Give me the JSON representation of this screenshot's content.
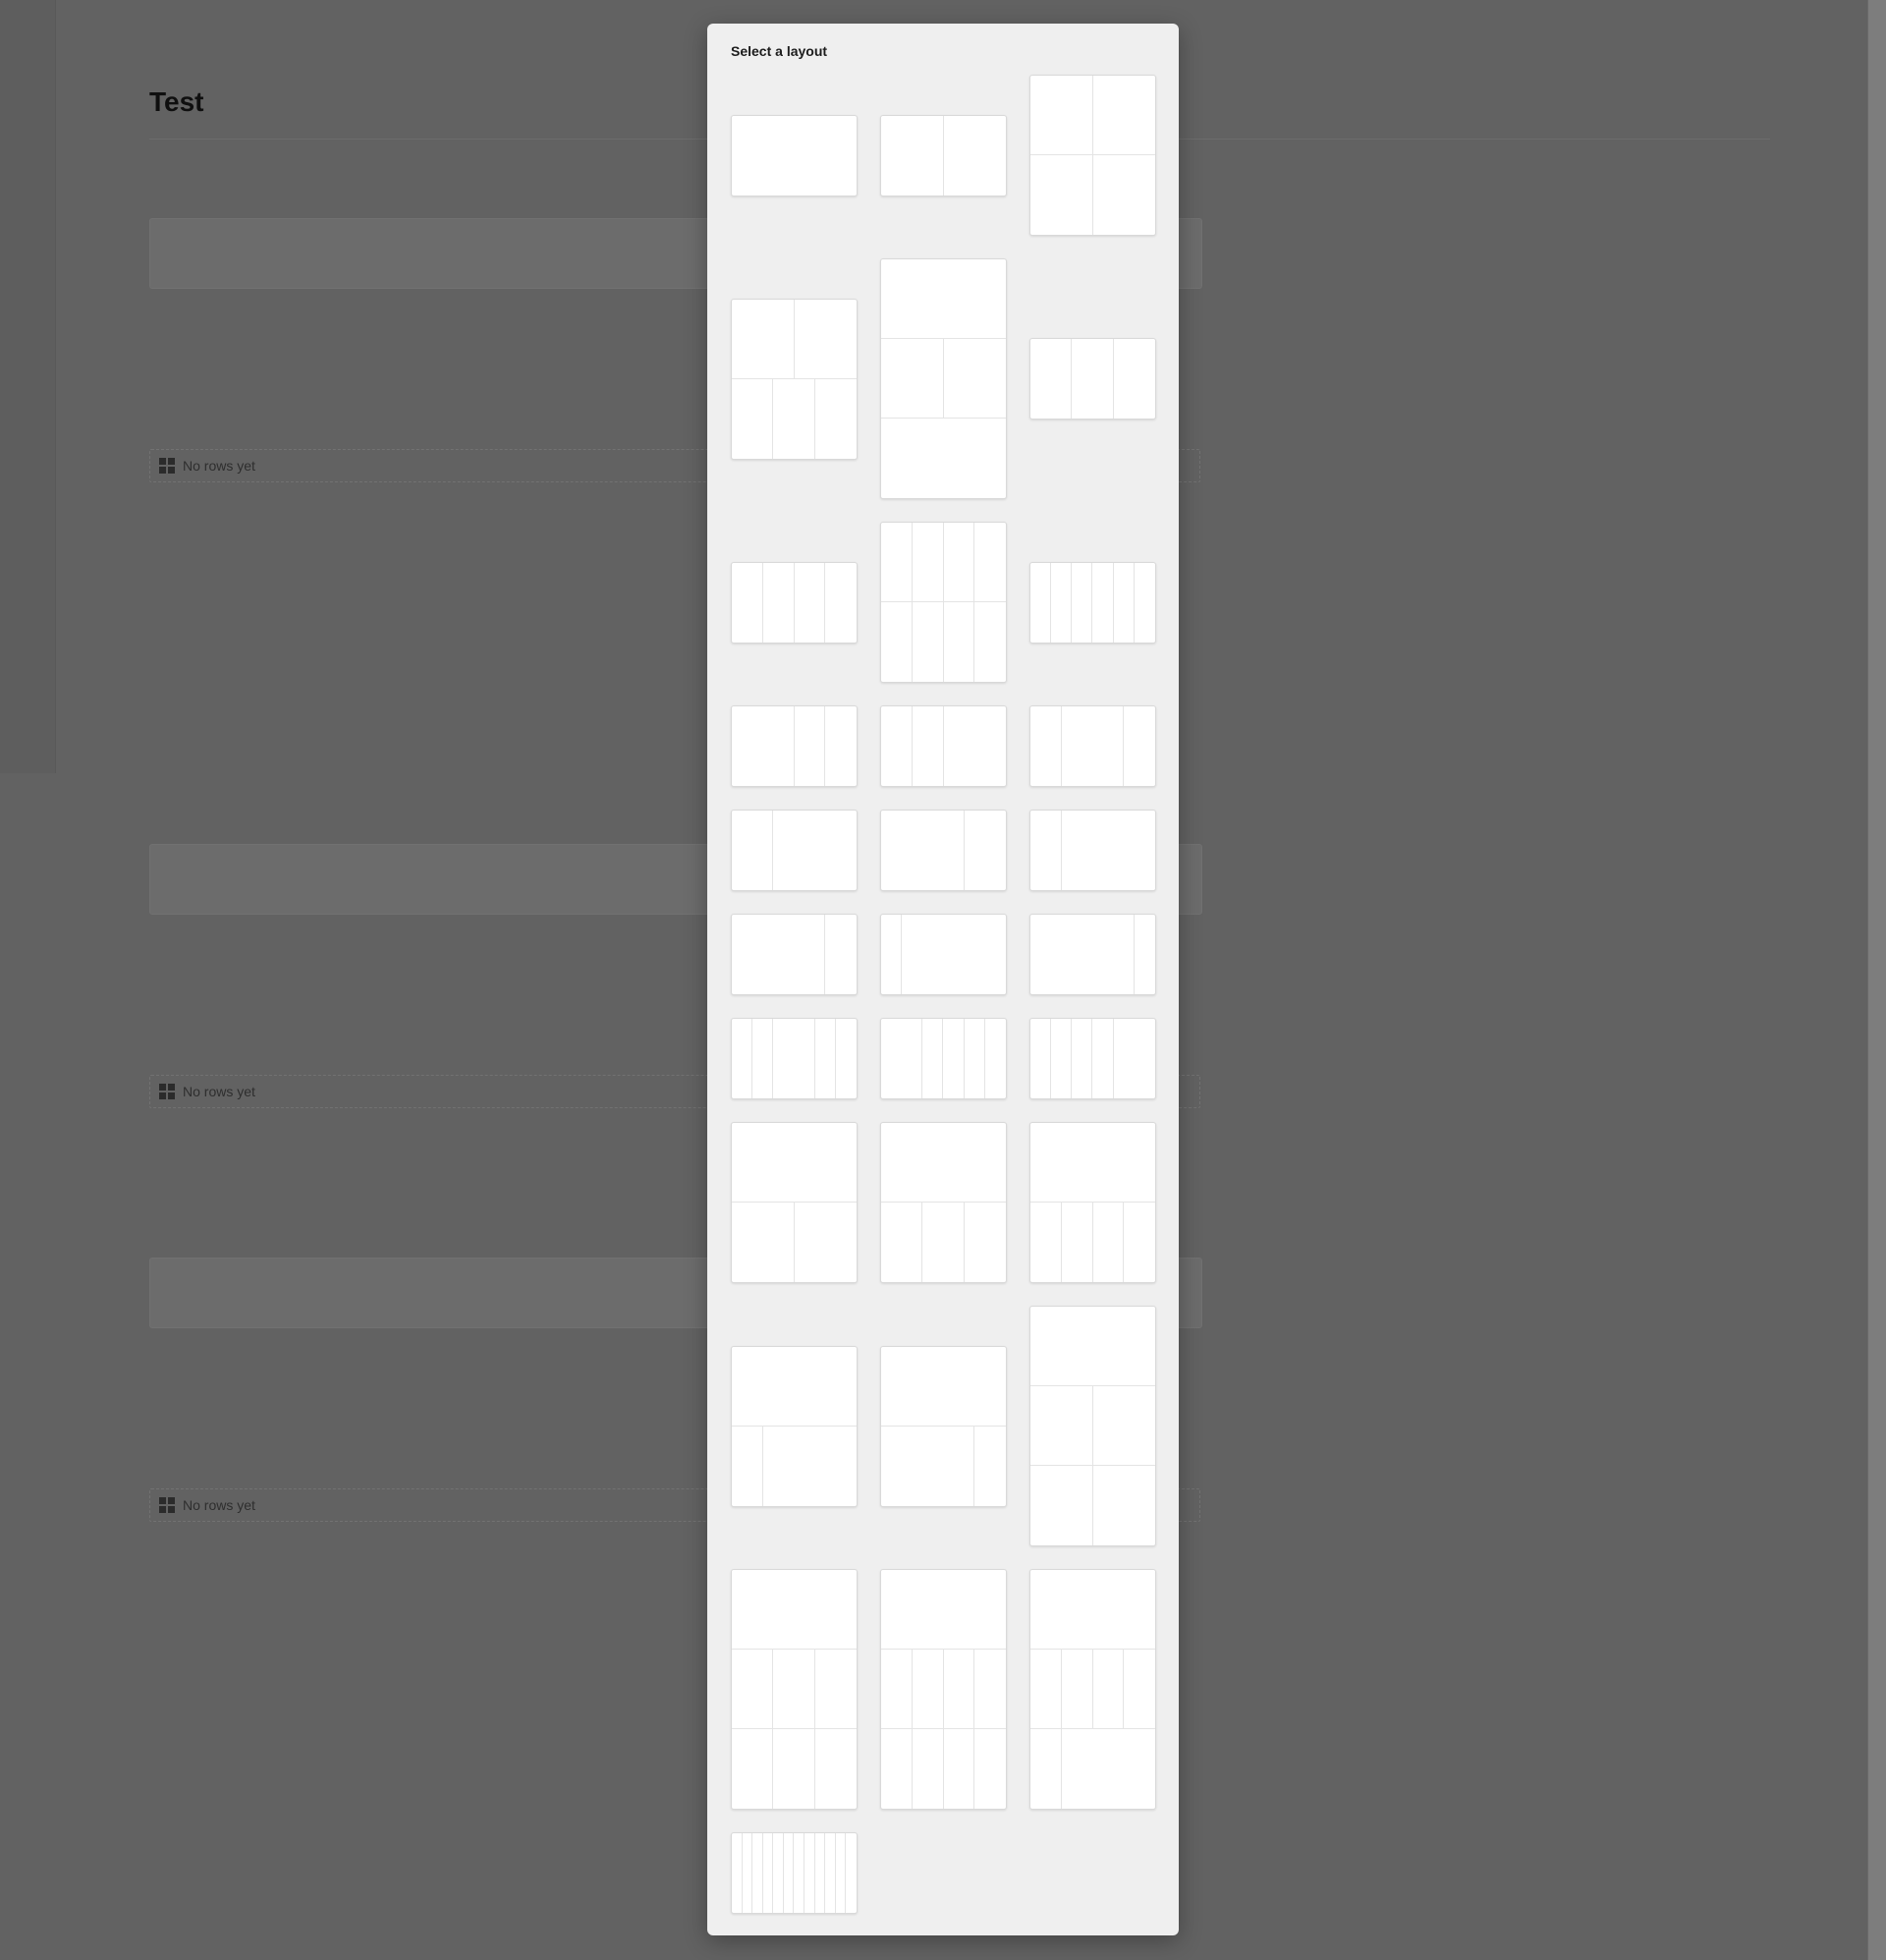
{
  "page": {
    "title": "Test",
    "empty_rows_label": "No rows yet"
  },
  "dialog": {
    "title": "Select a layout"
  },
  "layouts": [
    {
      "id": "full",
      "rows": [
        [
          1
        ]
      ]
    },
    {
      "id": "halves",
      "rows": [
        [
          1,
          1
        ]
      ]
    },
    {
      "id": "quad",
      "rows": [
        [
          1,
          1
        ],
        [
          1,
          1
        ]
      ]
    },
    {
      "id": "two-over-three",
      "rows": [
        [
          1,
          1
        ],
        [
          1,
          1,
          1
        ]
      ]
    },
    {
      "id": "full-halves-full",
      "rows": [
        [
          1
        ],
        [
          1,
          1
        ],
        [
          1
        ]
      ]
    },
    {
      "id": "thirds",
      "rows": [
        [
          1,
          1,
          1
        ]
      ]
    },
    {
      "id": "quarters",
      "rows": [
        [
          1,
          1,
          1,
          1
        ]
      ]
    },
    {
      "id": "quarters-2rows",
      "rows": [
        [
          1,
          1,
          1,
          1
        ],
        [
          1,
          1,
          1,
          1
        ]
      ]
    },
    {
      "id": "sixths",
      "rows": [
        [
          1,
          1,
          1,
          1,
          1,
          1
        ]
      ]
    },
    {
      "id": "half-quarter-quarter",
      "rows": [
        [
          2,
          1,
          1
        ]
      ]
    },
    {
      "id": "quarter-quarter-half",
      "rows": [
        [
          1,
          1,
          2
        ]
      ]
    },
    {
      "id": "quarter-half-quarter",
      "rows": [
        [
          1,
          2,
          1
        ]
      ]
    },
    {
      "id": "third-twothirds",
      "rows": [
        [
          1,
          2
        ]
      ]
    },
    {
      "id": "twothirds-third",
      "rows": [
        [
          2,
          1
        ]
      ]
    },
    {
      "id": "quarter-threequarters",
      "rows": [
        [
          1,
          3
        ]
      ]
    },
    {
      "id": "threequarters-quarter",
      "rows": [
        [
          3,
          1
        ]
      ]
    },
    {
      "id": "sixth-fivesixths",
      "rows": [
        [
          1,
          5
        ]
      ]
    },
    {
      "id": "fivesixths-sixth",
      "rows": [
        [
          5,
          1
        ]
      ]
    },
    {
      "id": "s-s-l-s-s",
      "rows": [
        [
          1,
          1,
          2,
          1,
          1
        ]
      ]
    },
    {
      "id": "l-s-s-s-s",
      "rows": [
        [
          2,
          1,
          1,
          1,
          1
        ]
      ]
    },
    {
      "id": "s-s-s-s-l",
      "rows": [
        [
          1,
          1,
          1,
          1,
          2
        ]
      ]
    },
    {
      "id": "full-halves",
      "rows": [
        [
          1
        ],
        [
          1,
          1
        ]
      ]
    },
    {
      "id": "full-thirds",
      "rows": [
        [
          1
        ],
        [
          1,
          1,
          1
        ]
      ]
    },
    {
      "id": "full-quarters",
      "rows": [
        [
          1
        ],
        [
          1,
          1,
          1,
          1
        ]
      ]
    },
    {
      "id": "full-quarter-threequarters",
      "rows": [
        [
          1
        ],
        [
          1,
          3
        ]
      ]
    },
    {
      "id": "full-threequarters-quarter",
      "rows": [
        [
          1
        ],
        [
          3,
          1
        ]
      ]
    },
    {
      "id": "full-halves-halves",
      "rows": [
        [
          1
        ],
        [
          1,
          1
        ],
        [
          1,
          1
        ]
      ]
    },
    {
      "id": "full-thirds-thirds",
      "rows": [
        [
          1
        ],
        [
          1,
          1,
          1
        ],
        [
          1,
          1,
          1
        ]
      ]
    },
    {
      "id": "full-quarters-quarters",
      "rows": [
        [
          1
        ],
        [
          1,
          1,
          1,
          1
        ],
        [
          1,
          1,
          1,
          1
        ]
      ]
    },
    {
      "id": "full-quarters-quarter-threequarters",
      "rows": [
        [
          1
        ],
        [
          1,
          1,
          1,
          1
        ],
        [
          1,
          3
        ]
      ]
    },
    {
      "id": "twelfths",
      "rows": [
        [
          1,
          1,
          1,
          1,
          1,
          1,
          1,
          1,
          1,
          1,
          1,
          1
        ]
      ]
    }
  ]
}
